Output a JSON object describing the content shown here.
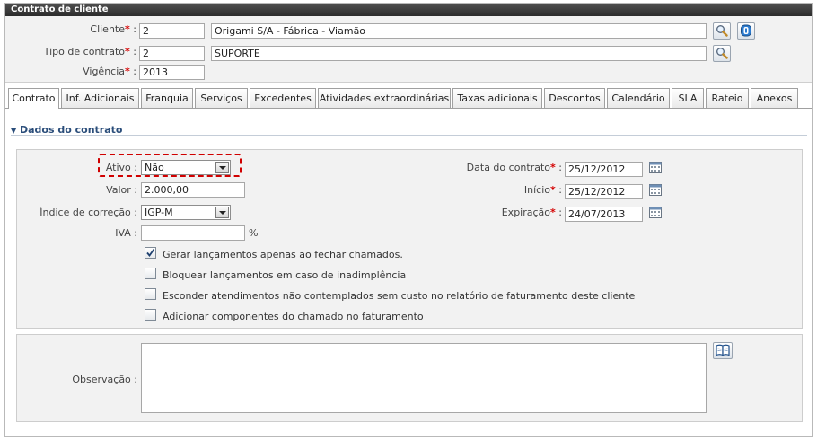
{
  "window": {
    "title": "Contrato de cliente"
  },
  "header": {
    "cliente": {
      "label": "Cliente",
      "code": "2",
      "name": "Origami S/A - Fábrica - Viamão"
    },
    "tipo": {
      "label": "Tipo de contrato",
      "code": "2",
      "name": "SUPORTE"
    },
    "vigencia": {
      "label": "Vigência",
      "value": "2013"
    },
    "colon": ":"
  },
  "tabs": [
    {
      "label": "Contrato",
      "active": true
    },
    {
      "label": "Inf. Adicionais"
    },
    {
      "label": "Franquia"
    },
    {
      "label": "Serviços"
    },
    {
      "label": "Excedentes"
    },
    {
      "label": "Atividades extraordinárias"
    },
    {
      "label": "Taxas adicionais"
    },
    {
      "label": "Descontos"
    },
    {
      "label": "Calendário"
    },
    {
      "label": "SLA"
    },
    {
      "label": "Rateio"
    },
    {
      "label": "Anexos"
    }
  ],
  "section": {
    "title": "Dados do contrato"
  },
  "fields": {
    "ativo": {
      "label": "Ativo :",
      "value": "Não"
    },
    "valor": {
      "label": "Valor :",
      "value": "2.000,00"
    },
    "indice": {
      "label": "Índice de correção :",
      "value": "IGP-M"
    },
    "iva": {
      "label": "IVA :",
      "value": "",
      "unit": "%"
    },
    "data_contrato": {
      "label": "Data do contrato",
      "value": "25/12/2012"
    },
    "inicio": {
      "label": "Início",
      "value": "25/12/2012"
    },
    "expiracao": {
      "label": "Expiração",
      "value": "24/07/2013"
    }
  },
  "checkboxes": [
    {
      "label": "Gerar lançamentos apenas ao fechar chamados.",
      "checked": true
    },
    {
      "label": "Bloquear lançamentos em caso de inadimplência",
      "checked": false
    },
    {
      "label": "Esconder atendimentos não contemplados sem custo no relatório de faturamento deste cliente",
      "checked": false
    },
    {
      "label": "Adicionar componentes do chamado no faturamento",
      "checked": false
    }
  ],
  "observacao": {
    "label": "Observação :",
    "value": ""
  },
  "colors": {
    "title_bar": "#3a3a3a",
    "required": "#d40000",
    "highlight": "#d00000",
    "section_title": "#2a4d7a"
  },
  "icons": [
    "search-icon",
    "info-icon",
    "calendar-icon",
    "book-icon",
    "chevron-down-icon"
  ]
}
